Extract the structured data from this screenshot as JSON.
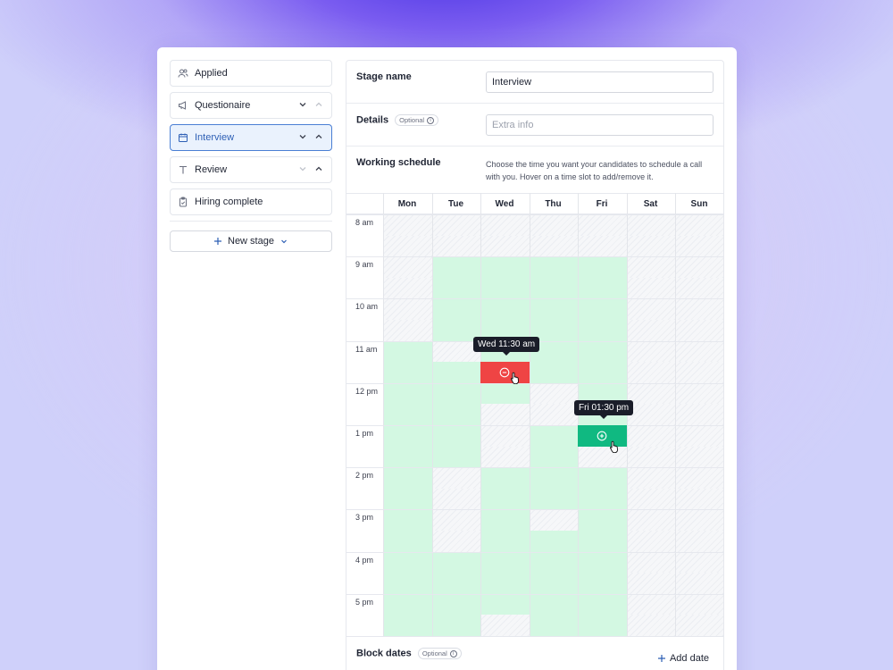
{
  "stages": [
    {
      "label": "Applied",
      "icon": "people-icon",
      "controls": false,
      "active": false
    },
    {
      "label": "Questionaire",
      "icon": "megaphone-icon",
      "controls": true,
      "active": false
    },
    {
      "label": "Interview",
      "icon": "calendar-icon",
      "controls": true,
      "active": true
    },
    {
      "label": "Review",
      "icon": "text-icon",
      "controls": true,
      "active": false
    },
    {
      "label": "Hiring complete",
      "icon": "clipboard-check-icon",
      "controls": false,
      "active": false
    }
  ],
  "new_stage_label": "New stage",
  "form": {
    "stage_name_label": "Stage name",
    "stage_name_value": "Interview",
    "details_label": "Details",
    "optional_badge": "Optional",
    "details_placeholder": "Extra info",
    "working_schedule_label": "Working schedule",
    "working_schedule_desc": "Choose the time you want your candidates to schedule a call with you. Hover on a time slot to add/remove it."
  },
  "schedule": {
    "days": [
      "Mon",
      "Tue",
      "Wed",
      "Thu",
      "Fri",
      "Sat",
      "Sun"
    ],
    "times": [
      "8 am",
      "9 am",
      "10 am",
      "11 am",
      "12 pm",
      "1 pm",
      "2 pm",
      "3 pm",
      "4 pm",
      "5 pm"
    ],
    "remove_tooltip": "Wed 11:30 am",
    "add_tooltip": "Fri 01:30 pm"
  },
  "block_dates": {
    "label": "Block dates",
    "optional_badge": "Optional",
    "add_label": "Add date"
  },
  "colors": {
    "available": "#d3f8e2",
    "remove": "#ef4444",
    "add": "#10b981",
    "active_stage": "#eaf2fd"
  }
}
